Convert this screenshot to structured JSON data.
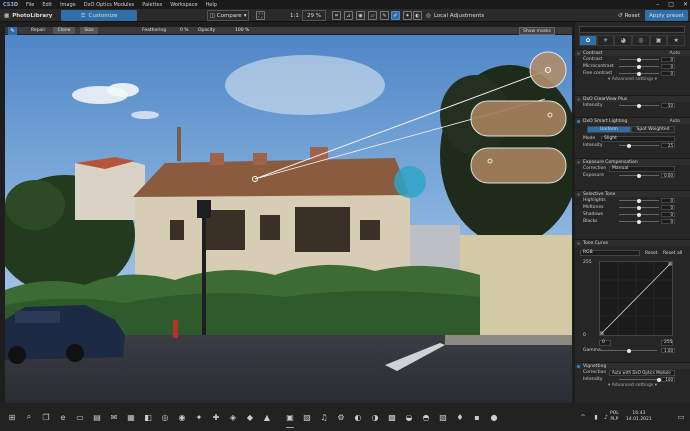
{
  "menubar": {
    "logo": "CS3D",
    "items": [
      "File",
      "Edit",
      "Image",
      "DxO Optics Modules",
      "Palettes",
      "Workspace",
      "Help"
    ],
    "win_min": "–",
    "win_max": "□",
    "win_close": "✕"
  },
  "toolbar": {
    "photolibrary": "PhotoLibrary",
    "customize": "Customize",
    "compare": "Compare",
    "one_to_one": "1:1",
    "zoom": "29 %",
    "local_adjustments": "Local Adjustments",
    "reset": "Reset",
    "apply_preset": "Apply preset"
  },
  "subbar": {
    "repair": "Repair",
    "clone": "Clone",
    "size_label": "Size",
    "feathering_label": "Feathering",
    "feathering_value": "0 %",
    "opacity_label": "Opacity",
    "opacity_value": "100 %",
    "show_mask": "Show masks"
  },
  "panel": {
    "contrast": {
      "title": "Contrast",
      "auto": "Auto",
      "rows": [
        {
          "label": "Contrast",
          "value": "0",
          "pos": 0.5
        },
        {
          "label": "Microcontrast",
          "value": "0",
          "pos": 0.5
        },
        {
          "label": "Fine contrast",
          "value": "0",
          "pos": 0.5
        }
      ],
      "advanced": "▾ Advanced settings ▾"
    },
    "clearview": {
      "title": "DxO ClearView Plus",
      "rows": [
        {
          "label": "Intensity",
          "value": "50",
          "pos": 0.5
        }
      ]
    },
    "smart_lighting": {
      "title": "DxO Smart Lighting",
      "auto": "Auto",
      "modes": [
        "Uniform",
        "Spot Weighted"
      ],
      "mode_label": "Mode",
      "mode_value": "Slight",
      "rows": [
        {
          "label": "Intensity",
          "value": "25",
          "pos": 0.25
        }
      ]
    },
    "exposure": {
      "title": "Exposure Compensation",
      "correction_label": "Correction",
      "correction_value": "Manual",
      "rows": [
        {
          "label": "Exposure",
          "value": "0.00",
          "pos": 0.5
        }
      ]
    },
    "selective_tone": {
      "title": "Selective Tone",
      "rows": [
        {
          "label": "Highlights",
          "value": "0",
          "pos": 0.5
        },
        {
          "label": "Midtones",
          "value": "0",
          "pos": 0.5
        },
        {
          "label": "Shadows",
          "value": "0",
          "pos": 0.5
        },
        {
          "label": "Blacks",
          "value": "0",
          "pos": 0.5
        }
      ]
    },
    "tone_curve": {
      "title": "Tone Curve",
      "channel": "RGB",
      "reset": "Reset",
      "reset_all": "Reset all",
      "top_value": "255",
      "bottom_left": "0",
      "input_min": "0",
      "input_max": "255",
      "gamma_label": "Gamma",
      "gamma_value": "1.00"
    },
    "vignetting": {
      "title": "Vignetting",
      "correction_label": "Correction",
      "correction_value": "Auto with DxO Optics Module",
      "rows": [
        {
          "label": "Intensity",
          "value": "100",
          "pos": 1.0
        }
      ],
      "advanced": "▾ Advanced settings ▾"
    }
  },
  "taskbar": {
    "lang_top": "POL",
    "lang_bottom": "PLP",
    "time": "16:43",
    "date": "14.01.2021"
  }
}
